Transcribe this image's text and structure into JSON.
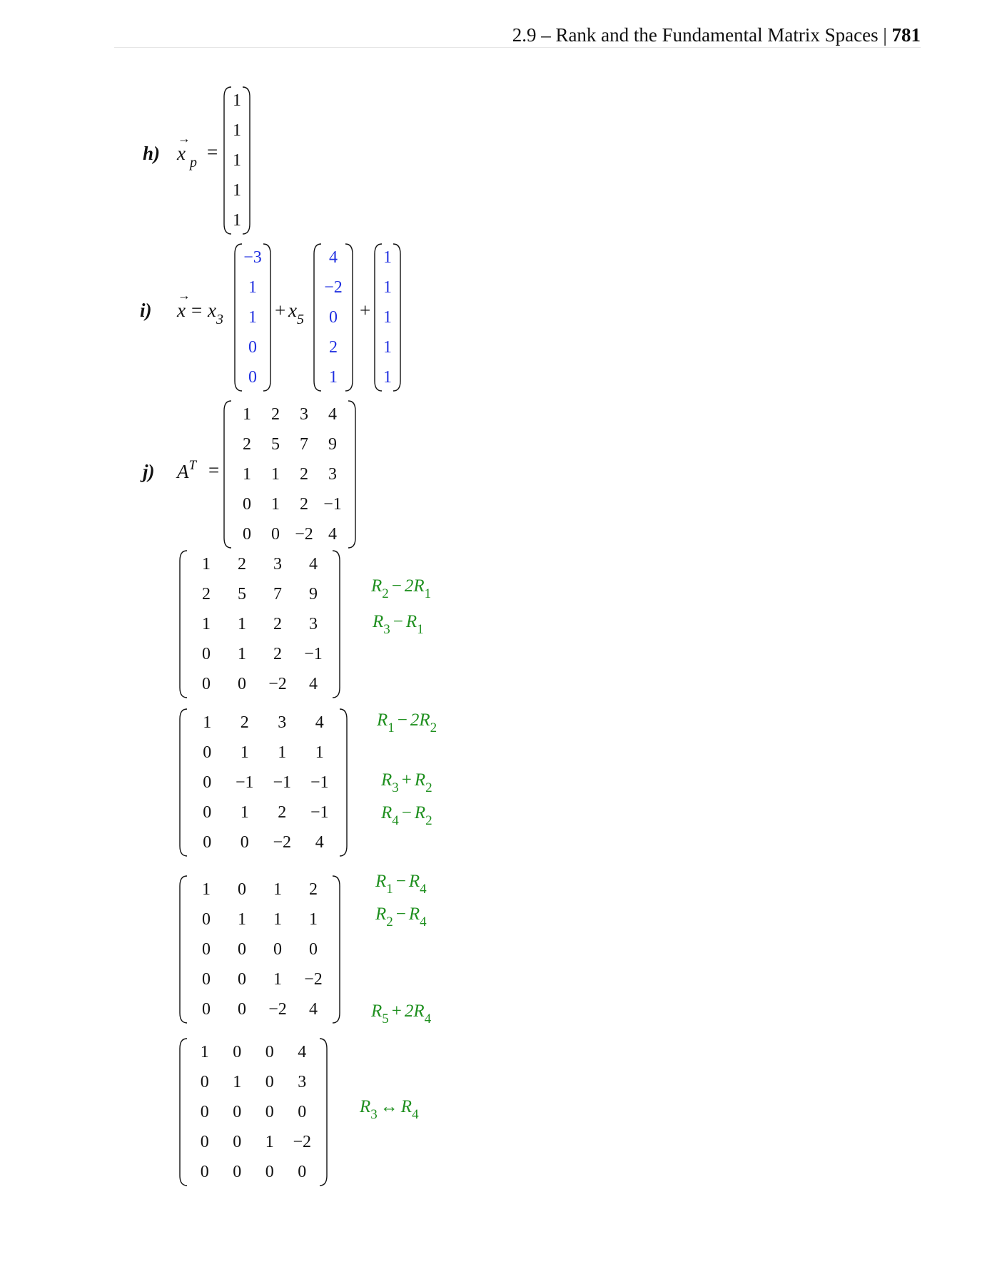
{
  "header": {
    "section": "2.9 – Rank and the Fundamental Matrix Spaces |",
    "page": "781"
  },
  "part_h": {
    "label": "h)",
    "var": "x",
    "sub": "p",
    "eq": "=",
    "vector": [
      "1",
      "1",
      "1",
      "1",
      "1"
    ]
  },
  "part_i": {
    "label": "i)",
    "var": "x",
    "eq": "=",
    "coef1": "x",
    "coef1_sub": "3",
    "plus1": "+",
    "coef2": "x",
    "coef2_sub": "5",
    "plus2": "+",
    "v1": [
      "−3",
      "1",
      "1",
      "0",
      "0"
    ],
    "v2": [
      "4",
      "−2",
      "0",
      "2",
      "1"
    ],
    "v3": [
      "1",
      "1",
      "1",
      "1",
      "1"
    ]
  },
  "part_j": {
    "label": "j)",
    "var": "A",
    "sup": "T",
    "eq": "=",
    "matrix": [
      [
        "1",
        "2",
        "3",
        "4"
      ],
      [
        "2",
        "5",
        "7",
        "9"
      ],
      [
        "1",
        "1",
        "2",
        "3"
      ],
      [
        "0",
        "1",
        "2",
        "−1"
      ],
      [
        "0",
        "0",
        "−2",
        "4"
      ]
    ]
  },
  "steps": [
    {
      "matrix": [
        [
          "1",
          "2",
          "3",
          "4"
        ],
        [
          "2",
          "5",
          "7",
          "9"
        ],
        [
          "1",
          "1",
          "2",
          "3"
        ],
        [
          "0",
          "1",
          "2",
          "−1"
        ],
        [
          "0",
          "0",
          "−2",
          "4"
        ]
      ],
      "ops": [
        {
          "a": "R",
          "as": "2",
          "op": "−",
          "c": "2R",
          "cs": "1"
        },
        {
          "a": "R",
          "as": "3",
          "op": "−",
          "c": "R",
          "cs": "1"
        }
      ]
    },
    {
      "matrix": [
        [
          "1",
          "2",
          "3",
          "4"
        ],
        [
          "0",
          "1",
          "1",
          "1"
        ],
        [
          "0",
          "−1",
          "−1",
          "−1"
        ],
        [
          "0",
          "1",
          "2",
          "−1"
        ],
        [
          "0",
          "0",
          "−2",
          "4"
        ]
      ],
      "ops": [
        {
          "a": "R",
          "as": "1",
          "op": "−",
          "c": "2R",
          "cs": "2"
        },
        {
          "a": "R",
          "as": "3",
          "op": "+",
          "c": "R",
          "cs": "2"
        },
        {
          "a": "R",
          "as": "4",
          "op": "−",
          "c": "R",
          "cs": "2"
        }
      ]
    },
    {
      "matrix": [
        [
          "1",
          "0",
          "1",
          "2"
        ],
        [
          "0",
          "1",
          "1",
          "1"
        ],
        [
          "0",
          "0",
          "0",
          "0"
        ],
        [
          "0",
          "0",
          "1",
          "−2"
        ],
        [
          "0",
          "0",
          "−2",
          "4"
        ]
      ],
      "ops": [
        {
          "a": "R",
          "as": "1",
          "op": "−",
          "c": "R",
          "cs": "4"
        },
        {
          "a": "R",
          "as": "2",
          "op": "−",
          "c": "R",
          "cs": "4"
        },
        {
          "a": "R",
          "as": "5",
          "op": "+",
          "c": "2R",
          "cs": "4"
        }
      ]
    },
    {
      "matrix": [
        [
          "1",
          "0",
          "0",
          "4"
        ],
        [
          "0",
          "1",
          "0",
          "3"
        ],
        [
          "0",
          "0",
          "0",
          "0"
        ],
        [
          "0",
          "0",
          "1",
          "−2"
        ],
        [
          "0",
          "0",
          "0",
          "0"
        ]
      ],
      "ops": [
        {
          "a": "R",
          "as": "3",
          "op": "↔",
          "c": "R",
          "cs": "4"
        }
      ]
    }
  ]
}
